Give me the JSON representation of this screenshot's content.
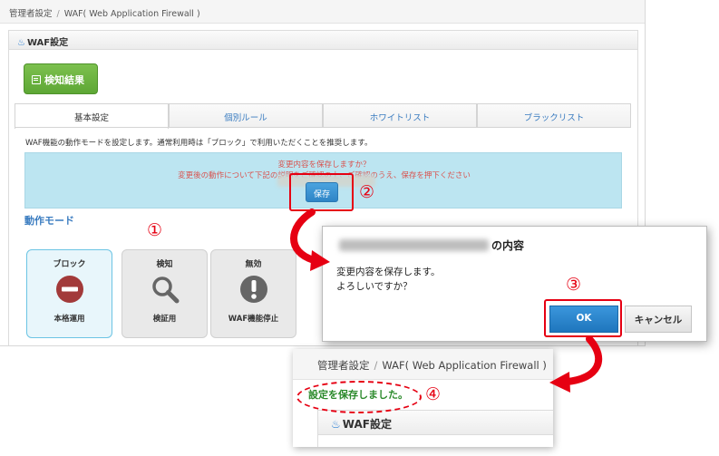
{
  "breadcrumb": {
    "root": "管理者設定",
    "separator": "/",
    "current": "WAF( Web Application Firewall )"
  },
  "section": {
    "title": "WAF設定"
  },
  "detect_button": {
    "label": "検知結果"
  },
  "tabs": [
    {
      "label": "基本設定",
      "active": true
    },
    {
      "label": "個別ルール",
      "active": false
    },
    {
      "label": "ホワイトリスト",
      "active": false
    },
    {
      "label": "ブラックリスト",
      "active": false
    }
  ],
  "description": "WAF機能の動作モードを設定します。通常利用時は「ブロック」で利用いただくことを推奨します。",
  "notice": {
    "line1": "変更内容を保存しますか？",
    "line2": "変更後の動作について下記の説明をご確認の上、ご確認のうえ、保存を押下ください"
  },
  "save_button": {
    "label": "保存"
  },
  "mode_title": "動作モード",
  "modes": [
    {
      "name": "ブロック",
      "sub": "本格運用",
      "icon": "no-entry-icon",
      "selected": true
    },
    {
      "name": "検知",
      "sub": "検証用",
      "icon": "magnifier-icon",
      "selected": false
    },
    {
      "name": "無効",
      "sub": "WAF機能停止",
      "icon": "exclamation-icon",
      "selected": false
    }
  ],
  "dialog": {
    "title_suffix": "の内容",
    "line1": "変更内容を保存します。",
    "line2": "よろしいですか？",
    "ok_label": "OK",
    "cancel_label": "キャンセル"
  },
  "result": {
    "breadcrumb_root": "管理者設定",
    "separator": "/",
    "breadcrumb_current": "WAF( Web Application Firewall )",
    "message": "設定を保存しました。",
    "section_title": "WAF設定"
  },
  "annotations": {
    "n1": "①",
    "n2": "②",
    "n3": "③",
    "n4": "④"
  },
  "colors": {
    "accent_red": "#e60012",
    "primary_blue": "#2e85c6",
    "success_green": "#2b8a2b",
    "notice_bg": "#bce5f1"
  }
}
